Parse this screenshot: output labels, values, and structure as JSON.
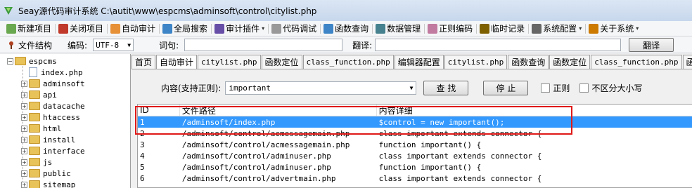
{
  "window": {
    "title": "Seay源代码审计系统  C:\\autit\\www\\espcms\\adminsoft\\control\\citylist.php"
  },
  "menu": [
    {
      "label": "新建项目",
      "icon": "new-project-icon"
    },
    {
      "label": "关闭项目",
      "icon": "close-project-icon"
    },
    {
      "label": "自动审计",
      "icon": "auto-audit-icon"
    },
    {
      "label": "全局搜索",
      "icon": "global-search-icon"
    },
    {
      "label": "审计插件",
      "icon": "plugin-icon",
      "dropdown": true
    },
    {
      "label": "代码调试",
      "icon": "code-debug-icon"
    },
    {
      "label": "函数查询",
      "icon": "function-search-icon"
    },
    {
      "label": "数据管理",
      "icon": "data-manage-icon"
    },
    {
      "label": "正则编码",
      "icon": "regex-encode-icon"
    },
    {
      "label": "临时记录",
      "icon": "temp-note-icon"
    },
    {
      "label": "系统配置",
      "icon": "gear-icon",
      "dropdown": true
    },
    {
      "label": "关于系统",
      "icon": "about-icon",
      "dropdown": true
    }
  ],
  "toolbar2": {
    "file_structure_label": "文件结构",
    "encoding_label": "编码:",
    "encoding_value": "UTF-8",
    "word_label": "词句:",
    "word_value": "",
    "translate_label": "翻译:",
    "translate_value": "",
    "translate_button": "翻译"
  },
  "tree": {
    "root": "espcms",
    "items": [
      {
        "label": "index.php",
        "type": "file"
      },
      {
        "label": "adminsoft",
        "type": "folder"
      },
      {
        "label": "api",
        "type": "folder"
      },
      {
        "label": "datacache",
        "type": "folder"
      },
      {
        "label": "htaccess",
        "type": "folder"
      },
      {
        "label": "html",
        "type": "folder"
      },
      {
        "label": "install",
        "type": "folder"
      },
      {
        "label": "interface",
        "type": "folder"
      },
      {
        "label": "js",
        "type": "folder"
      },
      {
        "label": "public",
        "type": "folder"
      },
      {
        "label": "sitemap",
        "type": "folder"
      }
    ]
  },
  "tabs": [
    {
      "label": "首页",
      "mono": false
    },
    {
      "label": "自动审计",
      "mono": false
    },
    {
      "label": "citylist.php",
      "mono": true
    },
    {
      "label": "函数定位",
      "mono": false
    },
    {
      "label": "class_function.php",
      "mono": true
    },
    {
      "label": "编辑器配置",
      "mono": false
    },
    {
      "label": "citylist.php",
      "mono": true
    },
    {
      "label": "函数查询",
      "mono": false
    },
    {
      "label": "函数定位",
      "mono": false
    },
    {
      "label": "class_function.php",
      "mono": true
    },
    {
      "label": "函数",
      "mono": false
    }
  ],
  "search": {
    "label": "内容(支持正则):",
    "value": "important",
    "search_button": "查 找",
    "stop_button": "停 止",
    "regex_label": "正则",
    "case_label": "不区分大小写"
  },
  "results": {
    "columns": [
      "ID",
      "文件路径",
      "内容详细"
    ],
    "rows": [
      {
        "id": "1",
        "path": "/adminsoft/index.php",
        "content": "$control = new important();"
      },
      {
        "id": "2",
        "path": "/adminsoft/control/acmessagemain.php",
        "content": "class important extends connector {"
      },
      {
        "id": "3",
        "path": "/adminsoft/control/acmessagemain.php",
        "content": "function important() {"
      },
      {
        "id": "4",
        "path": "/adminsoft/control/adminuser.php",
        "content": "class important extends connector {"
      },
      {
        "id": "5",
        "path": "/adminsoft/control/adminuser.php",
        "content": "function important() {"
      },
      {
        "id": "6",
        "path": "/adminsoft/control/advertmain.php",
        "content": "class important extends connector {"
      }
    ],
    "selected_index": 0
  },
  "colors": {
    "selection": "#3399ff",
    "highlight_box": "#e01818"
  }
}
